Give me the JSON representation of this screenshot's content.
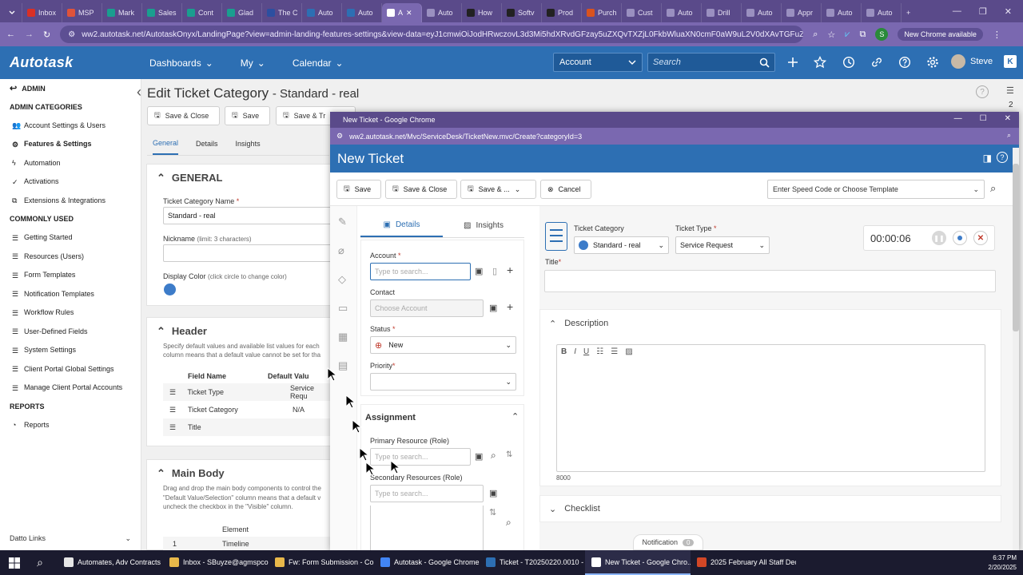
{
  "colors": {
    "chrome_frame": "#5a4a8a",
    "chrome_toolbar": "#7a68b0",
    "autotask_blue": "#2d6fb3",
    "close_red": "#c0392b",
    "display_color_circle": "#3d7cc9"
  },
  "browser": {
    "tabs": [
      {
        "label": "Inbox",
        "color": "#d93025"
      },
      {
        "label": "MSP",
        "color": "#e0533a"
      },
      {
        "label": "Mark",
        "color": "#1a9e8f"
      },
      {
        "label": "Sales",
        "color": "#1a9e8f"
      },
      {
        "label": "Cont",
        "color": "#1a9e8f"
      },
      {
        "label": "Glad",
        "color": "#1a9e8f"
      },
      {
        "label": "The C",
        "color": "#2c4fa0"
      },
      {
        "label": "Auto",
        "color": "#2d6fb3"
      },
      {
        "label": "Auto",
        "color": "#2d6fb3"
      },
      {
        "label": "A",
        "color": "#ffffff",
        "active": true
      },
      {
        "label": "Auto",
        "color": "#9a90c0"
      },
      {
        "label": "How",
        "color": "#222222"
      },
      {
        "label": "Softv",
        "color": "#222222"
      },
      {
        "label": "Prod",
        "color": "#222222"
      },
      {
        "label": "Purch",
        "color": "#d9531e"
      },
      {
        "label": "Cust",
        "color": "#9a90c0"
      },
      {
        "label": "Auto",
        "color": "#9a90c0"
      },
      {
        "label": "Drill",
        "color": "#9a90c0"
      },
      {
        "label": "Auto",
        "color": "#9a90c0"
      },
      {
        "label": "Appr",
        "color": "#9a90c0"
      },
      {
        "label": "Auto",
        "color": "#9a90c0"
      },
      {
        "label": "Auto",
        "color": "#9a90c0"
      }
    ],
    "url": "ww2.autotask.net/AutotaskOnyx/LandingPage?view=admin-landing-features-settings&view-data=eyJ1cmwiOiJodHRwczovL3d3Mi5hdXRvdGFzay5uZXQvTXZjL0FkbWluaXN0cmF0aW9uL2V0dXAvTGFuZGluZy5tdm...",
    "new_chrome": "New Chrome available",
    "profile_letter": "S"
  },
  "autotask": {
    "logo": "Autotask",
    "nav": [
      "Dashboards",
      "My",
      "Calendar"
    ],
    "account_select": "Account",
    "search_placeholder": "Search",
    "user": "Steve"
  },
  "sidebar": {
    "admin": "ADMIN",
    "categories_head": "ADMIN CATEGORIES",
    "categories": [
      "Account Settings & Users",
      "Features & Settings",
      "Automation",
      "Activations",
      "Extensions & Integrations"
    ],
    "common_head": "COMMONLY USED",
    "common": [
      "Getting Started",
      "Resources (Users)",
      "Form Templates",
      "Notification Templates",
      "Workflow Rules",
      "User-Defined Fields",
      "System Settings",
      "Client Portal Global Settings",
      "Manage Client Portal Accounts"
    ],
    "reports_head": "REPORTS",
    "reports": [
      "Reports"
    ],
    "datto_links": "Datto Links"
  },
  "bgpage": {
    "title": "Edit Ticket Category",
    "title_suffix": "- Standard - real",
    "buttons": [
      "Save & Close",
      "Save",
      "Save & Tr"
    ],
    "tabs": [
      "General",
      "Details",
      "Insights"
    ],
    "general_head": "GENERAL",
    "cat_name_label": "Ticket Category Name",
    "cat_name_value": "Standard - real",
    "nickname_label": "Nickname",
    "nickname_hint": "(limit: 3 characters)",
    "display_color_label": "Display Color",
    "display_color_hint": "(click circle to change color)",
    "header_head": "Header",
    "header_desc": "Specify default values and available list values for each column means that a default value cannot be set for tha",
    "header_cols": [
      "Field Name",
      "Default Valu"
    ],
    "header_rows": [
      {
        "name": "Ticket Type",
        "value": "Service Requ"
      },
      {
        "name": "Ticket Category",
        "value": "N/A"
      },
      {
        "name": "Title",
        "value": ""
      }
    ],
    "mainbody_head": "Main Body",
    "mainbody_desc1": "Drag and drop the main body components to control the",
    "mainbody_desc2": "\"Default Value/Selection\" column means that a default v",
    "mainbody_desc3": "uncheck the checkbox in the \"Visible\" column.",
    "element_col": "Element",
    "element_row_num": "1",
    "element_row_name": "Timeline",
    "page_num": "2"
  },
  "popup": {
    "window_title": "New Ticket - Google Chrome",
    "url": "ww2.autotask.net/Mvc/ServiceDesk/TicketNew.mvc/Create?categoryId=3",
    "heading": "New Ticket",
    "toolbar": {
      "save": "Save",
      "save_close": "Save & Close",
      "save_more": "Save & ...",
      "cancel": "Cancel",
      "template_placeholder": "Enter Speed Code or Choose Template"
    },
    "tabs": [
      "Details",
      "Insights"
    ],
    "account_label": "Account",
    "account_placeholder": "Type to search...",
    "contact_label": "Contact",
    "contact_placeholder": "Choose Account",
    "status_label": "Status",
    "status_value": "New",
    "priority_label": "Priority",
    "assignment_head": "Assignment",
    "primary_label": "Primary Resource (Role)",
    "primary_placeholder": "Type to search...",
    "secondary_label": "Secondary Resources (Role)",
    "secondary_placeholder": "Type to search...",
    "ticket_category_label": "Ticket Category",
    "ticket_category_value": "Standard - real",
    "ticket_type_label": "Ticket Type",
    "ticket_type_value": "Service Request",
    "timer": "00:00:06",
    "title_label": "Title",
    "description_head": "Description",
    "char_count": "8000",
    "checklist_head": "Checklist",
    "notification": "Notification",
    "notification_count": "0"
  },
  "taskbar": {
    "items": [
      {
        "label": "Automates, Adv Contracts ...",
        "color": "#e6e6e6"
      },
      {
        "label": "Inbox - SBuyze@agmspco...",
        "color": "#e8b84a"
      },
      {
        "label": "Fw: Form Submission - Co...",
        "color": "#e8b84a"
      },
      {
        "label": "Autotask - Google Chrome",
        "color": "#4285f4"
      },
      {
        "label": "Ticket - T20250220.0010 - K...",
        "color": "#2d6fb3"
      },
      {
        "label": "New Ticket - Google Chro...",
        "color": "#ffffff",
        "active": true
      },
      {
        "label": "2025 February All Staff Dec...",
        "color": "#d24726"
      }
    ],
    "time": "6:37 PM",
    "date": "2/20/2025"
  }
}
